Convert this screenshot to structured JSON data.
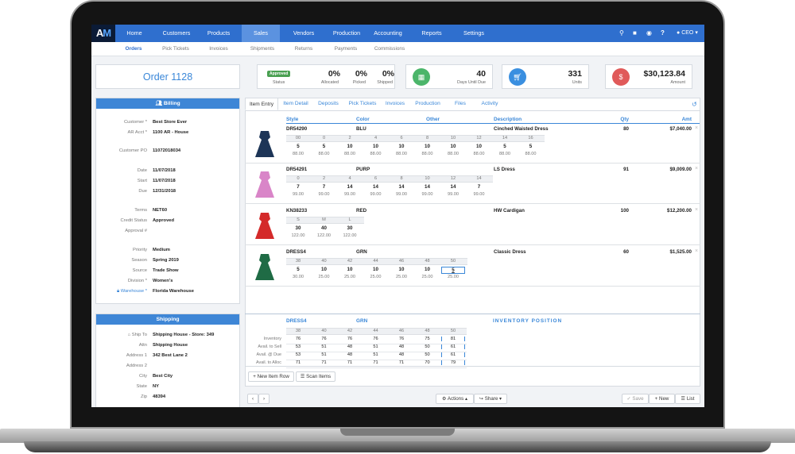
{
  "app": {
    "logo_left": "A",
    "logo_right": "M"
  },
  "topnav": {
    "items": [
      "Home",
      "Customers",
      "Products",
      "Sales",
      "Vendors",
      "Production",
      "Accounting",
      "Reports",
      "Settings"
    ],
    "active": "Sales",
    "user": "CEO"
  },
  "subnav": {
    "items": [
      "Orders",
      "Pick Tickets",
      "Invoices",
      "Shipments",
      "Returns",
      "Payments",
      "Commissions"
    ],
    "active": "Orders"
  },
  "order": {
    "title": "Order 1128"
  },
  "stats": {
    "status_badge": "Approved",
    "status_label": "Status",
    "allocated_value": "0%",
    "allocated_label": "Allocated",
    "picked_value": "0%",
    "picked_label": "Picked",
    "shipped_value": "0%",
    "shipped_label": "Shipped",
    "days_value": "40",
    "days_label": "Days Until Due",
    "units_value": "331",
    "units_label": "Units",
    "amount_value": "$30,123.84",
    "amount_label": "Amount"
  },
  "billing": {
    "title": "Billing",
    "fields": [
      {
        "label": "Customer *",
        "value": "Best Store Ever"
      },
      {
        "label": "AR Acct *",
        "value": "1100 AR - House"
      },
      {
        "label": "Customer PO",
        "value": "11072018034"
      },
      {
        "label": "Date",
        "value": "11/07/2018"
      },
      {
        "label": "Start",
        "value": "11/07/2018"
      },
      {
        "label": "Due",
        "value": "12/31/2018"
      },
      {
        "label": "Terms",
        "value": "NET60"
      },
      {
        "label": "Credit Status",
        "value": "Approved"
      },
      {
        "label": "Approval #",
        "value": ""
      },
      {
        "label": "Priority",
        "value": "Medium"
      },
      {
        "label": "Season",
        "value": "Spring 2019"
      },
      {
        "label": "Source",
        "value": "Trade Show"
      },
      {
        "label": "Division *",
        "value": "Women's"
      },
      {
        "label": "Warehouse *",
        "value": "Florida Warehouse"
      }
    ]
  },
  "shipping": {
    "title": "Shipping",
    "fields": [
      {
        "label": "Ship To",
        "value": "Shipping House - Store: 349"
      },
      {
        "label": "Attn",
        "value": "Shipping House"
      },
      {
        "label": "Address 1",
        "value": "342 Best Lane 2"
      },
      {
        "label": "Address 2",
        "value": ""
      },
      {
        "label": "City",
        "value": "Best City"
      },
      {
        "label": "State",
        "value": "NY"
      },
      {
        "label": "Zip",
        "value": "48394"
      }
    ]
  },
  "tabs": [
    "Item Entry",
    "Item Detail",
    "Deposits",
    "Pick Tickets",
    "Invoices",
    "Production",
    "Files",
    "Activity"
  ],
  "columns": {
    "style": "Style",
    "color": "Color",
    "other": "Other",
    "description": "Description",
    "qty": "Qty",
    "amt": "Amt"
  },
  "items": [
    {
      "style": "DR54290",
      "color": "BLU",
      "description": "Cinched Waisted Dress",
      "qty": "80",
      "amt": "$7,040.00",
      "sizes": [
        "00",
        "0",
        "2",
        "4",
        "6",
        "8",
        "10",
        "12",
        "14",
        "16"
      ],
      "qtys": [
        "5",
        "5",
        "10",
        "10",
        "10",
        "10",
        "10",
        "10",
        "5",
        "5"
      ],
      "prices": [
        "88.00",
        "88.00",
        "88.00",
        "88.00",
        "88.00",
        "88.00",
        "88.00",
        "88.00",
        "88.00",
        "88.00"
      ]
    },
    {
      "style": "DR54291",
      "color": "PURP",
      "description": "LS Dress",
      "qty": "91",
      "amt": "$9,009.00",
      "sizes": [
        "0",
        "2",
        "4",
        "6",
        "8",
        "10",
        "12",
        "14"
      ],
      "qtys": [
        "7",
        "7",
        "14",
        "14",
        "14",
        "14",
        "14",
        "7"
      ],
      "prices": [
        "99.00",
        "99.00",
        "99.00",
        "99.00",
        "99.00",
        "99.00",
        "99.00",
        "99.00"
      ]
    },
    {
      "style": "KN38233",
      "color": "RED",
      "description": "HW Cardigan",
      "qty": "100",
      "amt": "$12,200.00",
      "sizes": [
        "S",
        "M",
        "L"
      ],
      "qtys": [
        "30",
        "40",
        "30"
      ],
      "prices": [
        "122.00",
        "122.00",
        "122.00"
      ]
    },
    {
      "style": "DRESS4",
      "color": "GRN",
      "description": "Classic Dress",
      "qty": "60",
      "amt": "$1,525.00",
      "sizes": [
        "38",
        "40",
        "42",
        "44",
        "46",
        "48",
        "50"
      ],
      "qtys": [
        "5",
        "10",
        "10",
        "10",
        "10",
        "10",
        "5"
      ],
      "prices": [
        "30.00",
        "25.00",
        "25.00",
        "25.00",
        "25.00",
        "25.00",
        "25.00"
      ]
    }
  ],
  "inventory": {
    "style": "DRESS4",
    "color": "GRN",
    "title": "INVENTORY POSITION",
    "sizes": [
      "38",
      "40",
      "42",
      "44",
      "46",
      "48",
      "50"
    ],
    "rows": [
      {
        "label": "Inventory",
        "values": [
          "76",
          "76",
          "76",
          "76",
          "76",
          "75",
          "81"
        ]
      },
      {
        "label": "Avail. to Sell",
        "values": [
          "53",
          "51",
          "48",
          "51",
          "48",
          "50",
          "61"
        ]
      },
      {
        "label": "Avail. @ Due",
        "values": [
          "53",
          "51",
          "48",
          "51",
          "48",
          "50",
          "61"
        ]
      },
      {
        "label": "Avail. to Alloc",
        "values": [
          "71",
          "71",
          "71",
          "71",
          "71",
          "70",
          "79"
        ]
      }
    ]
  },
  "buttons": {
    "new_item_row": "New Item Row",
    "scan_items": "Scan Items",
    "prev": "‹",
    "next": "›",
    "actions": "Actions",
    "share": "Share",
    "save": "Save",
    "new": "New",
    "list": "List"
  },
  "colors": {
    "nav": "#2f6fce",
    "accent": "#3a87d8",
    "green": "#4bb56a",
    "blue": "#3a8fe0",
    "red": "#e05a5a",
    "badge": "#4aa052"
  }
}
